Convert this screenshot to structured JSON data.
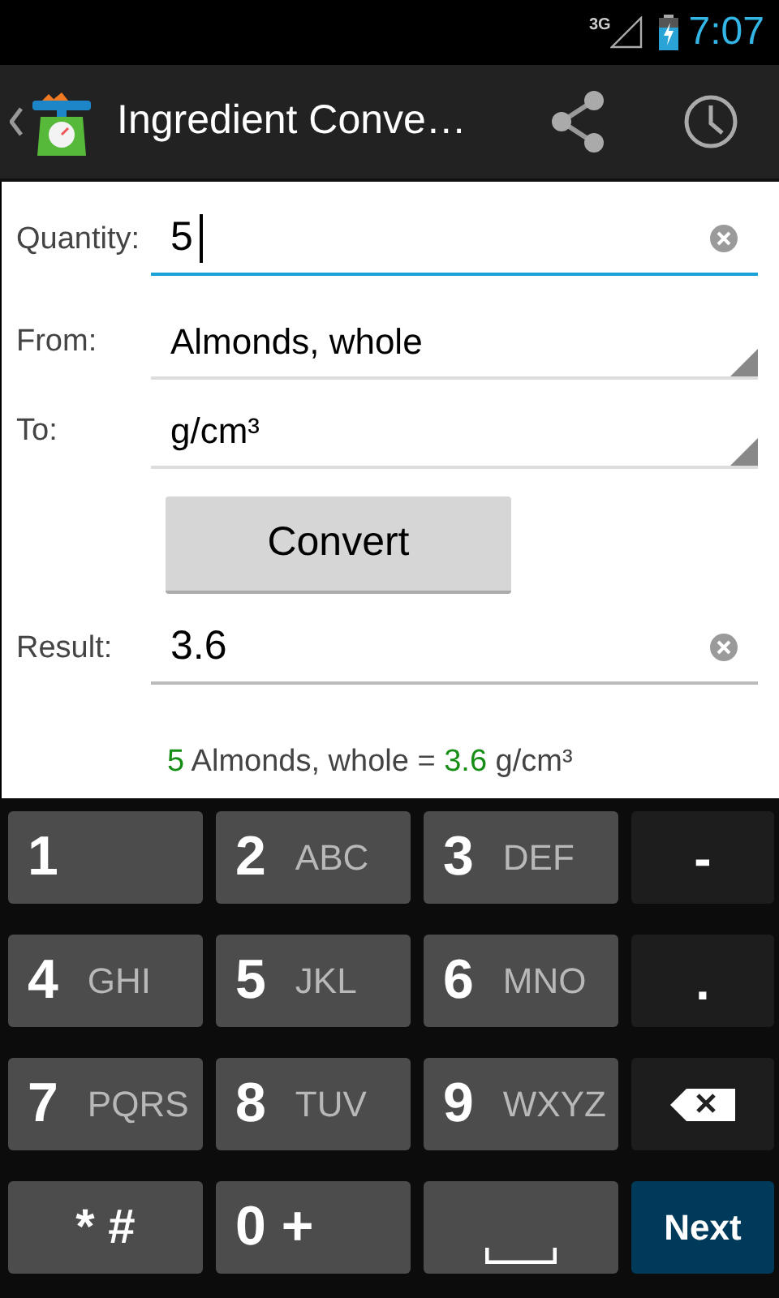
{
  "status_bar": {
    "network": "3G",
    "time": "7:07"
  },
  "action_bar": {
    "title": "Ingredient Conve…"
  },
  "quantity": {
    "label": "Quantity:",
    "value": "5",
    "focused": true
  },
  "from": {
    "label": "From:",
    "value": "Almonds, whole"
  },
  "to": {
    "label": "To:",
    "value": "g/cm³"
  },
  "convert_button": "Convert",
  "result": {
    "label": "Result:",
    "value": "3.6",
    "focused": false
  },
  "summary": [
    {
      "text": "5",
      "highlight": true
    },
    {
      "text": " Almonds, whole = ",
      "highlight": false
    },
    {
      "text": "3.6",
      "highlight": true
    },
    {
      "text": " g/cm³",
      "highlight": false
    }
  ],
  "keyboard": [
    {
      "kind": "digit",
      "main": "1"
    },
    {
      "kind": "digit",
      "main": "2",
      "sub": "ABC"
    },
    {
      "kind": "digit",
      "main": "3",
      "sub": "DEF"
    },
    {
      "kind": "function",
      "main": "-"
    },
    {
      "kind": "digit",
      "main": "4",
      "sub": "GHI"
    },
    {
      "kind": "digit",
      "main": "5",
      "sub": "JKL"
    },
    {
      "kind": "digit",
      "main": "6",
      "sub": "MNO"
    },
    {
      "kind": "function",
      "main": "."
    },
    {
      "kind": "digit",
      "main": "7",
      "sub": "PQRS"
    },
    {
      "kind": "digit",
      "main": "8",
      "sub": "TUV"
    },
    {
      "kind": "digit",
      "main": "9",
      "sub": "WXYZ"
    },
    {
      "kind": "backspace"
    },
    {
      "kind": "symbol",
      "main": "* #"
    },
    {
      "kind": "digit",
      "main": "0 +"
    },
    {
      "kind": "space"
    },
    {
      "kind": "action",
      "main": "Next"
    }
  ]
}
